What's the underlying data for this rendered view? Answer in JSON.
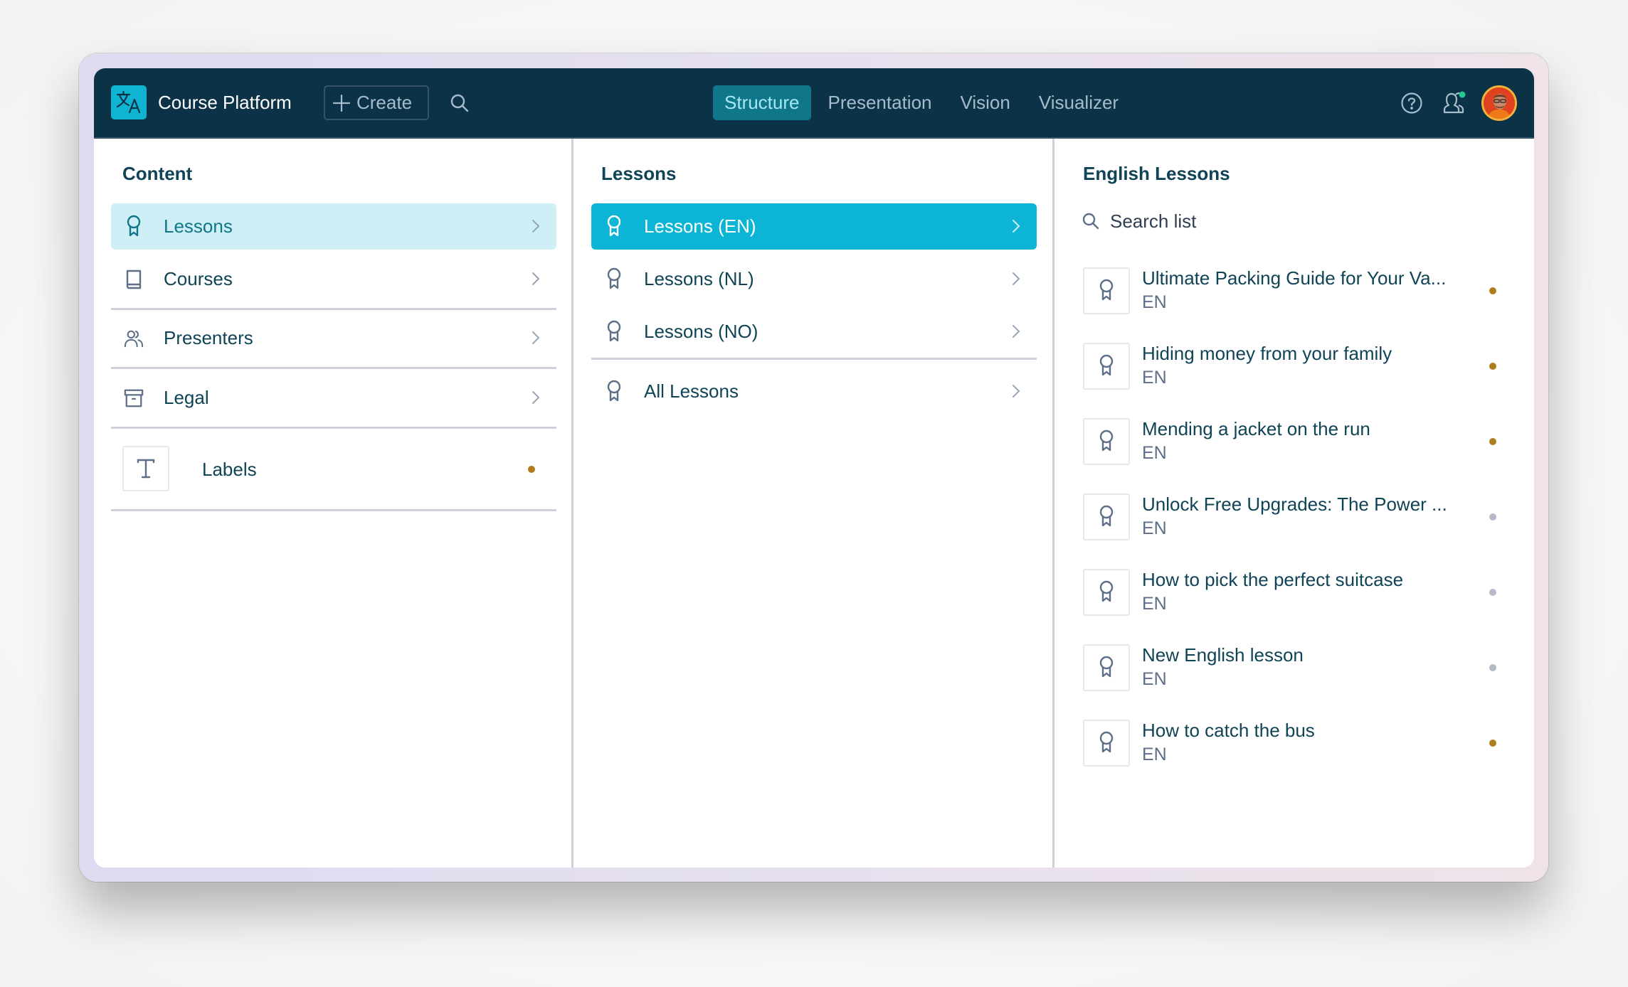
{
  "app": {
    "title": "Course Platform",
    "create_label": "Create"
  },
  "nav": {
    "tabs": [
      {
        "label": "Structure",
        "active": true
      },
      {
        "label": "Presentation",
        "active": false
      },
      {
        "label": "Vision",
        "active": false
      },
      {
        "label": "Visualizer",
        "active": false
      }
    ]
  },
  "header_icons": {
    "help": "help-circle-icon",
    "users": "users-icon",
    "users_status_color": "#1fc98f",
    "avatar": "user-avatar"
  },
  "content": {
    "title": "Content",
    "items": [
      {
        "label": "Lessons",
        "icon": "award-icon",
        "selected": true
      },
      {
        "label": "Courses",
        "icon": "book-icon"
      },
      {
        "label": "Presenters",
        "icon": "users-icon"
      },
      {
        "label": "Legal",
        "icon": "archive-icon"
      },
      {
        "label": "Labels",
        "icon": "text-icon",
        "status_color": "#b07d1c"
      }
    ]
  },
  "lessons": {
    "title": "Lessons",
    "items": [
      {
        "label": "Lessons (EN)",
        "selected": true
      },
      {
        "label": "Lessons (NL)"
      },
      {
        "label": "Lessons (NO)"
      },
      {
        "label": "All Lessons"
      }
    ]
  },
  "english_lessons": {
    "title": "English Lessons",
    "search_placeholder": "Search list",
    "items": [
      {
        "title": "Ultimate Packing Guide for Your Va...",
        "lang": "EN",
        "status": "changed",
        "status_color": "#b07d1c"
      },
      {
        "title": "Hiding money from your family",
        "lang": "EN",
        "status": "changed",
        "status_color": "#b07d1c"
      },
      {
        "title": "Mending a jacket on the run",
        "lang": "EN",
        "status": "changed",
        "status_color": "#b07d1c"
      },
      {
        "title": "Unlock Free Upgrades: The Power ...",
        "lang": "EN",
        "status": "draft",
        "status_color": "#b4bac7"
      },
      {
        "title": "How to pick the perfect suitcase",
        "lang": "EN",
        "status": "draft",
        "status_color": "#b4bac7"
      },
      {
        "title": "New English lesson",
        "lang": "EN",
        "status": "draft",
        "status_color": "#b4bac7"
      },
      {
        "title": "How to catch the bus",
        "lang": "EN",
        "status": "changed",
        "status_color": "#b07d1c"
      }
    ]
  },
  "colors": {
    "header_bg": "#0b3247",
    "accent": "#0cb5d6",
    "accent_light": "#cdeff5",
    "active_tab": "#10768a",
    "text_primary": "#0f4356"
  }
}
